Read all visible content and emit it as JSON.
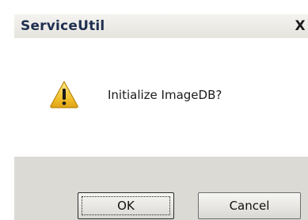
{
  "window": {
    "title": "ServiceUtil",
    "close_label": "X"
  },
  "message": {
    "text": "Initialize ImageDB?",
    "icon": "warning-icon"
  },
  "buttons": {
    "ok_label": "OK",
    "cancel_label": "Cancel"
  }
}
